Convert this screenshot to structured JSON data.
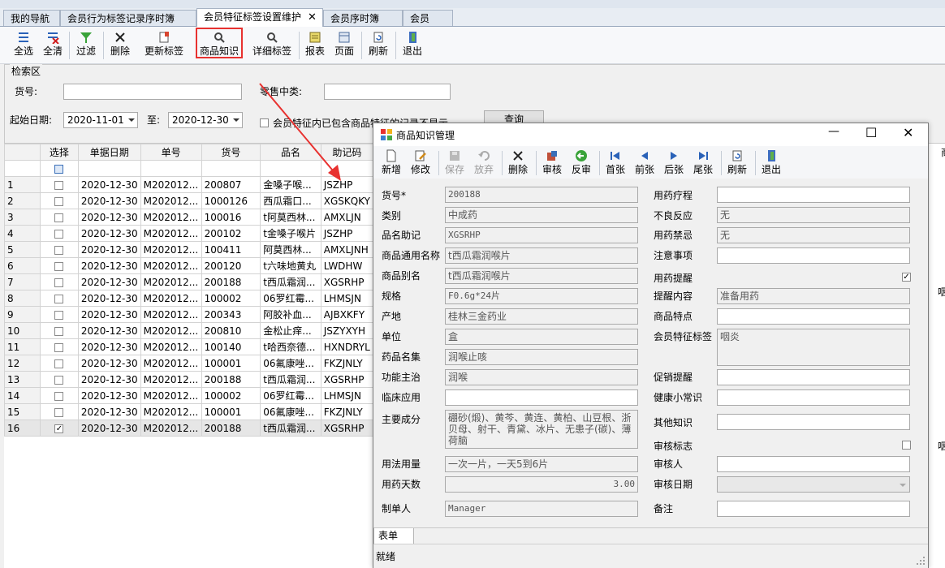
{
  "top_fragments": {
    "left": "...",
    "right": "..."
  },
  "tabs": [
    {
      "label": "我的导航"
    },
    {
      "label": "会员行为标签记录序时簿"
    },
    {
      "label": "会员特征标签设置维护",
      "close": "✕"
    },
    {
      "label": "会员序时簿"
    },
    {
      "label": "会员"
    }
  ],
  "toolbar": {
    "select_all": "全选",
    "clear_all": "全清",
    "filter": "过滤",
    "delete": "删除",
    "update_tags": "更新标签",
    "product_knowledge": "商品知识",
    "detail_tags": "详细标签",
    "report": "报表",
    "page": "页面",
    "refresh": "刷新",
    "exit": "退出"
  },
  "search": {
    "title": "检索区",
    "item_no_label": "货号:",
    "retail_category_label": "零售中类:",
    "start_date_label": "起始日期:",
    "start_date": "2020-11-01",
    "to_label": "至:",
    "end_date": "2020-12-30",
    "include_label": "会员特征内已包含商品特征的记录不显示",
    "query_button": "查询"
  },
  "grid": {
    "headers": [
      "选择",
      "单据日期",
      "单号",
      "货号",
      "品名",
      "助记码"
    ],
    "rows": [
      {
        "n": "1",
        "checked": false,
        "date": "2020-12-30",
        "no": "M202012...",
        "item": "200807",
        "name": "金嗓子喉...",
        "code": "JSZHP"
      },
      {
        "n": "2",
        "checked": false,
        "date": "2020-12-30",
        "no": "M202012...",
        "item": "1000126",
        "name": "西瓜霜口...",
        "code": "XGSKQKY"
      },
      {
        "n": "3",
        "checked": false,
        "date": "2020-12-30",
        "no": "M202012...",
        "item": "100016",
        "name": "t阿莫西林...",
        "code": "AMXLJN"
      },
      {
        "n": "4",
        "checked": false,
        "date": "2020-12-30",
        "no": "M202012...",
        "item": "200102",
        "name": "t金嗓子喉片",
        "code": "JSZHP"
      },
      {
        "n": "5",
        "checked": false,
        "date": "2020-12-30",
        "no": "M202012...",
        "item": "100411",
        "name": "阿莫西林...",
        "code": "AMXLJNH"
      },
      {
        "n": "6",
        "checked": false,
        "date": "2020-12-30",
        "no": "M202012...",
        "item": "200120",
        "name": "t六味地黄丸",
        "code": "LWDHW"
      },
      {
        "n": "7",
        "checked": false,
        "date": "2020-12-30",
        "no": "M202012...",
        "item": "200188",
        "name": "t西瓜霜润...",
        "code": "XGSRHP"
      },
      {
        "n": "8",
        "checked": false,
        "date": "2020-12-30",
        "no": "M202012...",
        "item": "100002",
        "name": "06罗红霉...",
        "code": "LHMSJN"
      },
      {
        "n": "9",
        "checked": false,
        "date": "2020-12-30",
        "no": "M202012...",
        "item": "200343",
        "name": "阿胶补血...",
        "code": "AJBXKFY"
      },
      {
        "n": "10",
        "checked": false,
        "date": "2020-12-30",
        "no": "M202012...",
        "item": "200810",
        "name": "金松止痒...",
        "code": "JSZYXYH"
      },
      {
        "n": "11",
        "checked": false,
        "date": "2020-12-30",
        "no": "M202012...",
        "item": "100140",
        "name": "t哈西奈德...",
        "code": "HXNDRYL"
      },
      {
        "n": "12",
        "checked": false,
        "date": "2020-12-30",
        "no": "M202012...",
        "item": "100001",
        "name": "06氟康唑...",
        "code": "FKZJNLY"
      },
      {
        "n": "13",
        "checked": false,
        "date": "2020-12-30",
        "no": "M202012...",
        "item": "200188",
        "name": "t西瓜霜润...",
        "code": "XGSRHP"
      },
      {
        "n": "14",
        "checked": false,
        "date": "2020-12-30",
        "no": "M202012...",
        "item": "100002",
        "name": "06罗红霉...",
        "code": "LHMSJN"
      },
      {
        "n": "15",
        "checked": false,
        "date": "2020-12-30",
        "no": "M202012...",
        "item": "100001",
        "name": "06氟康唑...",
        "code": "FKZJNLY"
      },
      {
        "n": "16",
        "checked": true,
        "date": "2020-12-30",
        "no": "M202012...",
        "item": "200188",
        "name": "t西瓜霜润...",
        "code": "XGSRHP"
      }
    ]
  },
  "peek": {
    "header": "商",
    "r7": "咽",
    "r13": "",
    "r16": "咽"
  },
  "dialog": {
    "title": "商品知识管理",
    "window_min": "—",
    "window_max": "☐",
    "window_close": "✕",
    "toolbar": {
      "new": "新增",
      "edit": "修改",
      "save": "保存",
      "discard": "放弃",
      "delete": "删除",
      "audit": "审核",
      "unaudit": "反审",
      "first": "首张",
      "prev": "前张",
      "next": "后张",
      "last": "尾张",
      "refresh": "刷新",
      "exit": "退出"
    },
    "left": {
      "item_no": {
        "label": "货号*",
        "value": "200188"
      },
      "category": {
        "label": "类别",
        "value": "中成药"
      },
      "mnemonic": {
        "label": "品名助记",
        "value": "XGSRHP"
      },
      "generic_name": {
        "label": "商品通用名称",
        "value": "t西瓜霜润喉片"
      },
      "alias": {
        "label": "商品别名",
        "value": "t西瓜霜润喉片"
      },
      "spec": {
        "label": "规格",
        "value": "F0.6g*24片"
      },
      "origin": {
        "label": "产地",
        "value": "桂林三金药业"
      },
      "unit": {
        "label": "单位",
        "value": "盒"
      },
      "collection": {
        "label": "药品名集",
        "value": "润喉止咳"
      },
      "function": {
        "label": "功能主治",
        "value": "润喉"
      },
      "clinical": {
        "label": "临床应用",
        "value": ""
      },
      "ingredients": {
        "label": "主要成分",
        "value": "硼砂(煅)、黄芩、黄连、黄柏、山豆根、浙贝母、射干、青黛、冰片、无患子(碳)、薄荷脑"
      },
      "dosage": {
        "label": "用法用量",
        "value": "一次一片，一天5到6片"
      },
      "days": {
        "label": "用药天数",
        "value": "3.00"
      },
      "maker": {
        "label": "制单人",
        "value": "Manager"
      }
    },
    "right": {
      "course": {
        "label": "用药疗程",
        "value": ""
      },
      "adverse": {
        "label": "不良反应",
        "value": "无"
      },
      "contra": {
        "label": "用药禁忌",
        "value": "无"
      },
      "notes": {
        "label": "注意事项",
        "value": ""
      },
      "remind": {
        "label": "用药提醒",
        "checked": true
      },
      "remind_content": {
        "label": "提醒内容",
        "value": "准备用药"
      },
      "features": {
        "label": "商品特点",
        "value": ""
      },
      "member_tags": {
        "label": "会员特征标签",
        "value": "咽炎"
      },
      "promo": {
        "label": "促销提醒",
        "value": ""
      },
      "health": {
        "label": "健康小常识",
        "value": ""
      },
      "other": {
        "label": "其他知识",
        "value": ""
      },
      "audit_flag": {
        "label": "审核标志",
        "checked": false
      },
      "auditor": {
        "label": "审核人",
        "value": ""
      },
      "audit_date": {
        "label": "审核日期",
        "value": ""
      },
      "remark": {
        "label": "备注",
        "value": ""
      }
    },
    "bottom_tab": "表单",
    "status": "就绪"
  },
  "colors": {
    "highlight": "#e8312f",
    "arrow": "#e8312f",
    "tab_bg": "#dfe6ef"
  }
}
